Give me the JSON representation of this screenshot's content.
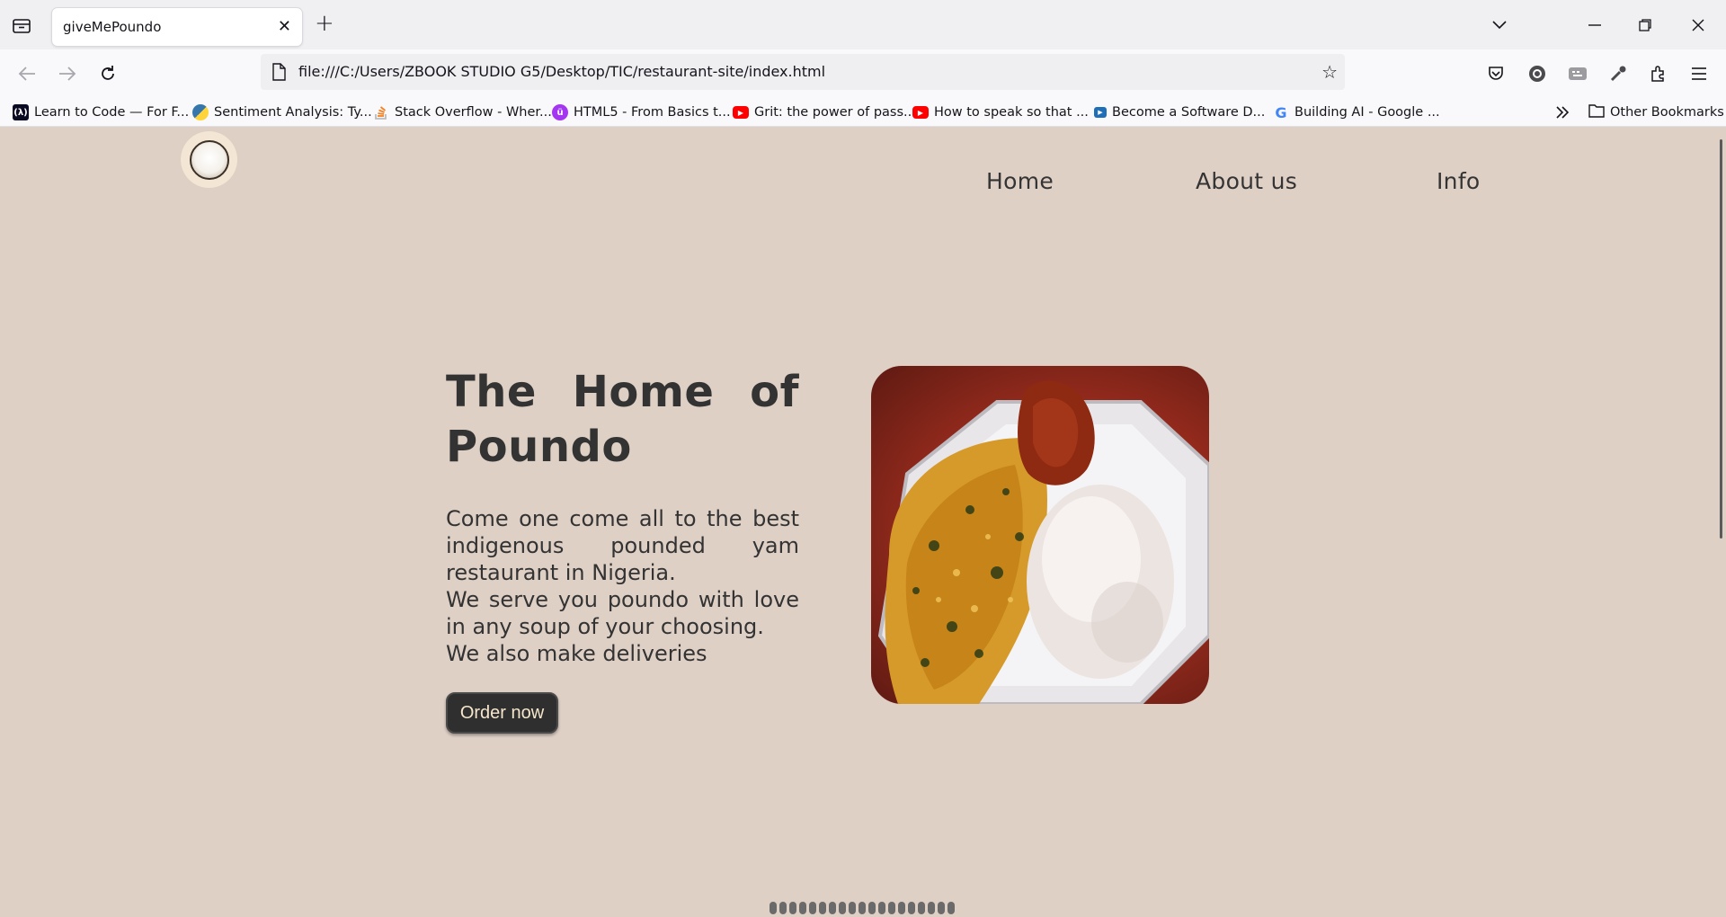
{
  "browser": {
    "tab_title": "giveMePoundo",
    "url": "file:///C:/Users/ZBOOK STUDIO G5/Desktop/TIC/restaurant-site/index.html",
    "bookmarks": [
      {
        "label": "Learn to Code — For F...",
        "icon": "freecodecamp-icon",
        "color": "#0a0a23"
      },
      {
        "label": "Sentiment Analysis: Ty...",
        "icon": "python-icon",
        "color": "#3776ab"
      },
      {
        "label": "Stack Overflow - Wher...",
        "icon": "stackoverflow-icon",
        "color": "#f48024"
      },
      {
        "label": "HTML5 - From Basics t...",
        "icon": "udemy-icon",
        "color": "#a435f0"
      },
      {
        "label": "Grit: the power of pass...",
        "icon": "youtube-icon",
        "color": "#ff0000"
      },
      {
        "label": "How to speak so that ...",
        "icon": "youtube-icon",
        "color": "#ff0000"
      },
      {
        "label": "Become a Software D...",
        "icon": "video-icon",
        "color": "#1f6fb8"
      },
      {
        "label": "Building AI - Google ...",
        "icon": "google-icon",
        "color": "#4285f4"
      }
    ],
    "other_bookmarks": "Other Bookmarks"
  },
  "site": {
    "nav": {
      "home": "Home",
      "about": "About us",
      "info": "Info"
    },
    "hero": {
      "title": "The Home of Poundo",
      "lines": [
        "Come one come all to the best indigenous pounded yam restaurant in Nigeria.",
        "We serve you poundo with love in any soup of your choosing.",
        "We also make deliveries"
      ],
      "cta": "Order now",
      "image_alt": "pounded-yam-with-egusi-soup"
    },
    "colors": {
      "background": "#dfd0c6",
      "text": "#333333",
      "button_bg": "#2f2f2f",
      "button_text": "#f5e6cc"
    }
  }
}
